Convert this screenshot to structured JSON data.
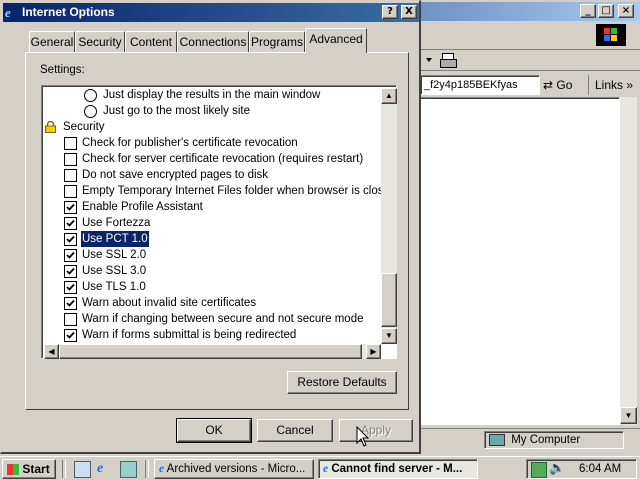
{
  "browser": {
    "address_text": "_f2y4p185BEKfyas",
    "go_label": "Go",
    "links_label": "Links",
    "status_zone": "My Computer"
  },
  "dialog": {
    "title": "Internet Options",
    "help_label": "?",
    "close_label": "X",
    "tabs": [
      {
        "label": "General"
      },
      {
        "label": "Security"
      },
      {
        "label": "Content"
      },
      {
        "label": "Connections"
      },
      {
        "label": "Programs"
      },
      {
        "label": "Advanced"
      }
    ],
    "active_tab": "Advanced",
    "settings_label": "Settings:",
    "items": [
      {
        "kind": "radio",
        "label": "Just display the results in the main window",
        "checked": false
      },
      {
        "kind": "radio",
        "label": "Just go to the most likely site",
        "checked": false
      },
      {
        "kind": "group",
        "label": "Security"
      },
      {
        "kind": "check",
        "label": "Check for publisher's certificate revocation",
        "checked": false
      },
      {
        "kind": "check",
        "label": "Check for server certificate revocation (requires restart)",
        "checked": false
      },
      {
        "kind": "check",
        "label": "Do not save encrypted pages to disk",
        "checked": false
      },
      {
        "kind": "check",
        "label": "Empty Temporary Internet Files folder when browser is closed",
        "checked": false
      },
      {
        "kind": "check",
        "label": "Enable Profile Assistant",
        "checked": true
      },
      {
        "kind": "check",
        "label": "Use Fortezza",
        "checked": true
      },
      {
        "kind": "check",
        "label": "Use PCT 1.0",
        "checked": true,
        "selected": true
      },
      {
        "kind": "check",
        "label": "Use SSL 2.0",
        "checked": true
      },
      {
        "kind": "check",
        "label": "Use SSL 3.0",
        "checked": true
      },
      {
        "kind": "check",
        "label": "Use TLS 1.0",
        "checked": true
      },
      {
        "kind": "check",
        "label": "Warn about invalid site certificates",
        "checked": true
      },
      {
        "kind": "check",
        "label": "Warn if changing between secure and not secure mode",
        "checked": false
      },
      {
        "kind": "check",
        "label": "Warn if forms submittal is being redirected",
        "checked": true
      }
    ],
    "restore_label": "Restore Defaults",
    "ok_label": "OK",
    "cancel_label": "Cancel",
    "apply_label": "Apply"
  },
  "taskbar": {
    "start_label": "Start",
    "tasks": [
      {
        "label": "Archived versions - Micro...",
        "active": false
      },
      {
        "label": "Cannot find server - M...",
        "active": true
      }
    ],
    "clock": "6:04 AM"
  },
  "colors": {
    "title_active": "#0a246a",
    "selection": "#0a246a",
    "face": "#d4d0c8"
  }
}
